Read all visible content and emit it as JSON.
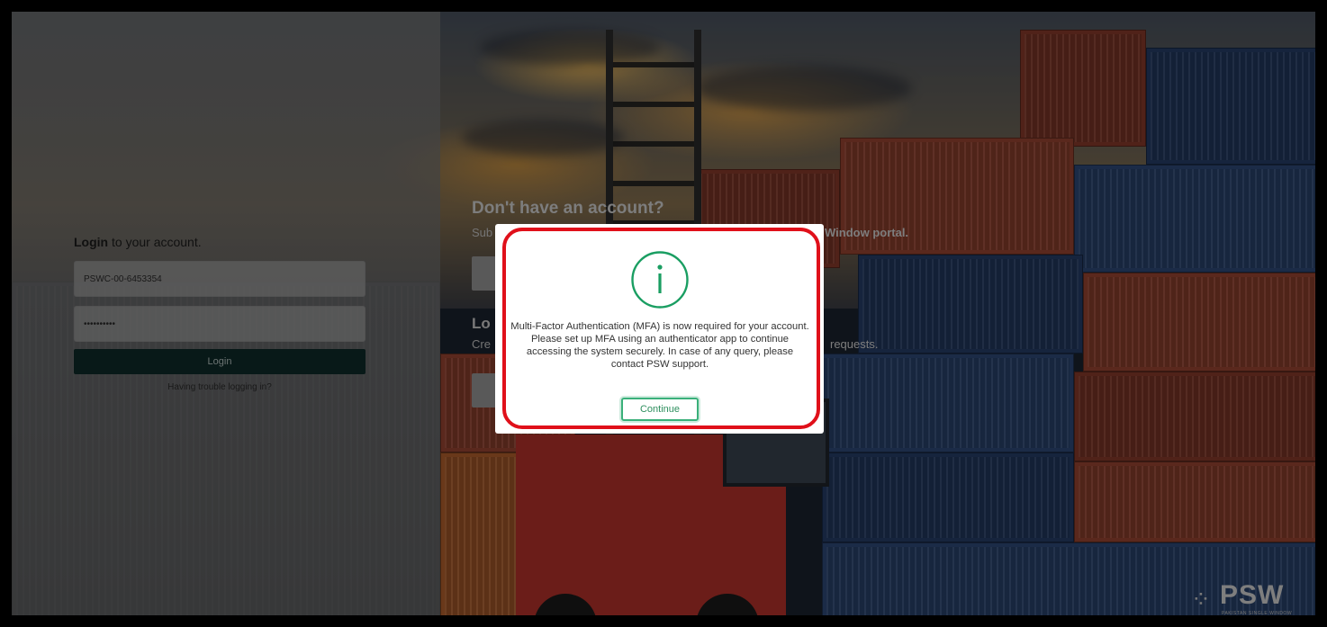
{
  "login": {
    "title_bold": "Login",
    "title_rest": " to your account.",
    "username_value": "PSWC-00-6453354",
    "password_value": "••••••••••",
    "login_button": "Login",
    "trouble_link": "Having trouble logging in?"
  },
  "right_panel": {
    "signup_title": "Don't have an account?",
    "signup_sub_partial": "Sub",
    "signup_sub_tail": "Window portal.",
    "second_title_partial": "Lo",
    "second_sub_partial": "Cre",
    "second_sub_tail": "requests."
  },
  "modal": {
    "icon": "info-circle-icon",
    "message": "Multi-Factor Authentication (MFA) is now required for your account. Please set up MFA using an authenticator app to continue accessing the system securely. In case of any query, please contact PSW support.",
    "continue_button": "Continue",
    "accent_color": "#1a9e62",
    "highlight_color": "#e0101a"
  },
  "logo": {
    "text": "PSW",
    "subtext": "PAKISTAN SINGLE WINDOW"
  }
}
